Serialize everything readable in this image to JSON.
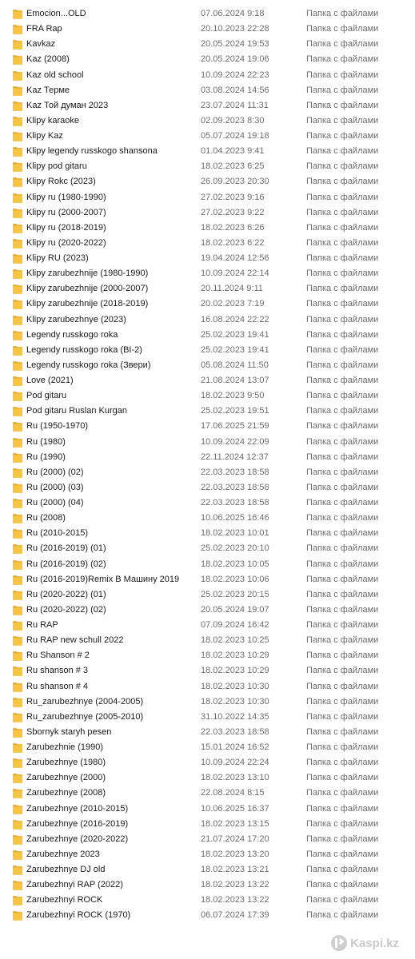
{
  "file_type": "Папка с файлами",
  "folder_color": "#f7c544",
  "rows": [
    {
      "name": "Emocion...OLD",
      "date": "07.06.2024 9:18"
    },
    {
      "name": "FRA Rap",
      "date": "20.10.2023 22:28"
    },
    {
      "name": "Kavkaz",
      "date": "20.05.2024 19:53"
    },
    {
      "name": "Kaz (2008)",
      "date": "20.05.2024 19:06"
    },
    {
      "name": "Kaz old school",
      "date": "10.09.2024 22:23"
    },
    {
      "name": "Kaz Терме",
      "date": "03.08.2024 14:56"
    },
    {
      "name": "Kaz Той думан 2023",
      "date": "23.07.2024 11:31"
    },
    {
      "name": "Klipy karaoke",
      "date": "02.09.2023 8:30"
    },
    {
      "name": "Klipy Kaz",
      "date": "05.07.2024 19:18"
    },
    {
      "name": "Klipy legendy russkogo shansona",
      "date": "01.04.2023 9:41"
    },
    {
      "name": "Klipy pod gitaru",
      "date": "18.02.2023 6:25"
    },
    {
      "name": "Klipy Rokc (2023)",
      "date": "26.09.2023 20:30"
    },
    {
      "name": "Klipy ru (1980-1990)",
      "date": "27.02.2023 9:16"
    },
    {
      "name": "Klipy ru (2000-2007)",
      "date": "27.02.2023 9:22"
    },
    {
      "name": "Klipy ru (2018-2019)",
      "date": "18.02.2023 6:26"
    },
    {
      "name": "Klipy ru (2020-2022)",
      "date": "18.02.2023 6:22"
    },
    {
      "name": "Klipy RU (2023)",
      "date": "19.04.2024 12:56"
    },
    {
      "name": "Klipy zarubezhnije (1980-1990)",
      "date": "10.09.2024 22:14"
    },
    {
      "name": "Klipy zarubezhnije (2000-2007)",
      "date": "20.11.2024 9:11"
    },
    {
      "name": "Klipy zarubezhnije (2018-2019)",
      "date": "20.02.2023 7:19"
    },
    {
      "name": "Klipy zarubezhnye (2023)",
      "date": "16.08.2024 22:22"
    },
    {
      "name": "Legendy russkogo roka",
      "date": "25.02.2023 19:41"
    },
    {
      "name": "Legendy russkogo roka (BI-2)",
      "date": "25.02.2023 19:41"
    },
    {
      "name": "Legendy russkogo roka (Звери)",
      "date": "05.08.2024 11:50"
    },
    {
      "name": "Love (2021)",
      "date": "21.08.2024 13:07"
    },
    {
      "name": "Pod gitaru",
      "date": "18.02.2023 9:50"
    },
    {
      "name": "Pod gitaru Ruslan Kurgan",
      "date": "25.02.2023 19:51"
    },
    {
      "name": "Ru (1950-1970)",
      "date": "17.06.2025 21:59"
    },
    {
      "name": "Ru (1980)",
      "date": "10.09.2024 22:09"
    },
    {
      "name": "Ru (1990)",
      "date": "22.11.2024 12:37"
    },
    {
      "name": "Ru (2000) (02)",
      "date": "22.03.2023 18:58"
    },
    {
      "name": "Ru (2000) (03)",
      "date": "22.03.2023 18:58"
    },
    {
      "name": "Ru (2000) (04)",
      "date": "22.03.2023 18:58"
    },
    {
      "name": "Ru (2008)",
      "date": "10.06.2025 16:46"
    },
    {
      "name": "Ru (2010-2015)",
      "date": "18.02.2023 10:01"
    },
    {
      "name": "Ru (2016-2019) (01)",
      "date": "25.02.2023 20:10"
    },
    {
      "name": "Ru (2016-2019) (02)",
      "date": "18.02.2023 10:05"
    },
    {
      "name": "Ru (2016-2019)Remix В Машину 2019",
      "date": "18.02.2023 10:06"
    },
    {
      "name": "Ru (2020-2022) (01)",
      "date": "25.02.2023 20:15"
    },
    {
      "name": "Ru (2020-2022) (02)",
      "date": "20.05.2024 19:07"
    },
    {
      "name": "Ru RAP",
      "date": "07.09.2024 16:42"
    },
    {
      "name": "Ru RAP new schull 2022",
      "date": "18.02.2023 10:25"
    },
    {
      "name": "Ru Shanson # 2",
      "date": "18.02.2023 10:29"
    },
    {
      "name": "Ru shanson # 3",
      "date": "18.02.2023 10:29"
    },
    {
      "name": "Ru shanson # 4",
      "date": "18.02.2023 10:30"
    },
    {
      "name": "Ru_zarubezhnye (2004-2005)",
      "date": "18.02.2023 10:30"
    },
    {
      "name": "Ru_zarubezhnye (2005-2010)",
      "date": "31.10.2022 14:35"
    },
    {
      "name": "Sbornyk staryh pesen",
      "date": "22.03.2023 18:58"
    },
    {
      "name": "Zarubezhnie (1990)",
      "date": "15.01.2024 16:52"
    },
    {
      "name": "Zarubezhnye (1980)",
      "date": "10.09.2024 22:24"
    },
    {
      "name": "Zarubezhnye (2000)",
      "date": "18.02.2023 13:10"
    },
    {
      "name": "Zarubezhnye (2008)",
      "date": "22.08.2024 8:15"
    },
    {
      "name": "Zarubezhnye (2010-2015)",
      "date": "10.06.2025 16:37"
    },
    {
      "name": "Zarubezhnye (2016-2019)",
      "date": "18.02.2023 13:15"
    },
    {
      "name": "Zarubezhnye (2020-2022)",
      "date": "21.07.2024 17:20"
    },
    {
      "name": "Zarubezhnye 2023",
      "date": "18.02.2023 13:20"
    },
    {
      "name": "Zarubezhnye DJ old",
      "date": "18.02.2023 13:21"
    },
    {
      "name": "Zarubezhnyi RAP (2022)",
      "date": "18.02.2023 13:22"
    },
    {
      "name": "Zarubezhnyi ROCK",
      "date": "18.02.2023 13:22"
    },
    {
      "name": "Zarubezhnyi ROCK (1970)",
      "date": "06.07.2024 17:39"
    }
  ],
  "watermark": {
    "text": "Kaspi.kz",
    "icon": "kaspi-logo-icon"
  }
}
